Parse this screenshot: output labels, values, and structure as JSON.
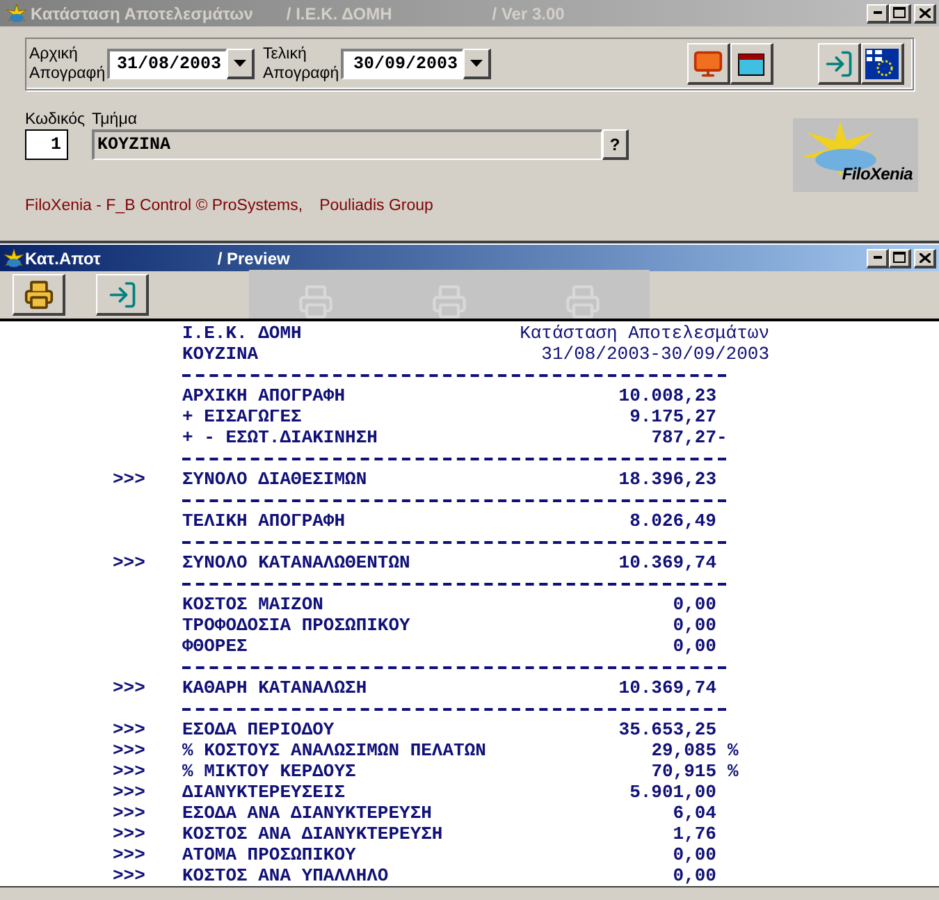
{
  "main_window": {
    "title": "Κατάσταση Αποτελεσμάτων",
    "title_org": "/ Ι.Ε.Κ. ΔΟΜΗ",
    "title_version": "/ Ver 3.00",
    "active": false
  },
  "period": {
    "start_label": "Αρχική Απογραφή",
    "start_value": "31/08/2003",
    "end_label": "Τελική Απογραφή",
    "end_value": "30/09/2003"
  },
  "department": {
    "code_label": "Κωδικός",
    "code_value": "1",
    "name_label": "Τμήμα",
    "name_value": "ΚΟΥΖΙΝΑ",
    "lookup": "?"
  },
  "logo": {
    "text": "FiloXenia"
  },
  "footer": {
    "credits": "FiloXenia - F_B Control © ProSystems,",
    "group": "Pouliadis Group"
  },
  "preview_window": {
    "title": "Κατ.Αποτ",
    "subtitle": "/ Preview",
    "active": true
  },
  "report": {
    "header": [
      {
        "left": "Ι.Ε.Κ. ΔΟΜΗ",
        "right": "Κατάσταση Αποτελεσμάτων"
      },
      {
        "left": "ΚΟΥΖΙΝΑ",
        "right": "31/08/2003-30/09/2003"
      }
    ],
    "lines": [
      {
        "kind": "rule"
      },
      {
        "kind": "item",
        "label": "ΑΡΧΙΚΗ ΑΠΟΓΡΑΦΗ",
        "value": "10.008,23"
      },
      {
        "kind": "item",
        "label": "+ ΕΙΣΑΓΩΓΕΣ",
        "value": "9.175,27"
      },
      {
        "kind": "item",
        "label": "+ - ΕΣΩΤ.ΔΙΑΚΙΝΗΣΗ",
        "value": "787,27",
        "sign": "-"
      },
      {
        "kind": "rule"
      },
      {
        "kind": "item",
        "marker": ">>>",
        "label": "ΣΥΝΟΛΟ ΔΙΑΘΕΣΙΜΩΝ",
        "value": "18.396,23"
      },
      {
        "kind": "rule"
      },
      {
        "kind": "item",
        "label": "ΤΕΛΙΚΗ ΑΠΟΓΡΑΦΗ",
        "value": "8.026,49"
      },
      {
        "kind": "rule"
      },
      {
        "kind": "item",
        "marker": ">>>",
        "label": "ΣΥΝΟΛΟ ΚΑΤΑΝΑΛΩΘΕΝΤΩΝ",
        "value": "10.369,74"
      },
      {
        "kind": "rule"
      },
      {
        "kind": "item",
        "label": "ΚΟΣΤΟΣ ΜΑΙΖΟΝ",
        "value": "0,00"
      },
      {
        "kind": "item",
        "label": "ΤΡΟΦΟΔΟΣΙΑ ΠΡΟΣΩΠΙΚΟΥ",
        "value": "0,00"
      },
      {
        "kind": "item",
        "label": "ΦΘΟΡΕΣ",
        "value": "0,00"
      },
      {
        "kind": "rule"
      },
      {
        "kind": "item",
        "marker": ">>>",
        "label": "ΚΑΘΑΡΗ ΚΑΤΑΝΑΛΩΣΗ",
        "value": "10.369,74"
      },
      {
        "kind": "rule"
      },
      {
        "kind": "item",
        "marker": ">>>",
        "label": "ΕΣΟΔΑ ΠΕΡΙΟΔΟΥ",
        "value": "35.653,25"
      },
      {
        "kind": "item",
        "marker": ">>>",
        "label": "% ΚΟΣΤΟΥΣ ΑΝΑΛΩΣΙΜΩΝ ΠΕΛΑΤΩΝ",
        "value": "29,085",
        "unit": "%"
      },
      {
        "kind": "item",
        "marker": ">>>",
        "label": "% ΜΙΚΤΟΥ ΚΕΡΔΟΥΣ",
        "value": "70,915",
        "unit": "%"
      },
      {
        "kind": "item",
        "marker": ">>>",
        "label": "ΔΙΑΝΥΚΤΕΡΕΥΣΕΙΣ",
        "value": "5.901,00"
      },
      {
        "kind": "item",
        "marker": ">>>",
        "label": "ΕΣΟΔΑ ΑΝΑ ΔΙΑΝΥΚΤΕΡΕΥΣΗ",
        "value": "6,04"
      },
      {
        "kind": "item",
        "marker": ">>>",
        "label": "ΚΟΣΤΟΣ ΑΝΑ ΔΙΑΝΥΚΤΕΡΕΥΣΗ",
        "value": "1,76"
      },
      {
        "kind": "item",
        "marker": ">>>",
        "label": "ΑΤΟΜΑ ΠΡΟΣΩΠΙΚΟΥ",
        "value": "0,00"
      },
      {
        "kind": "item",
        "marker": ">>>",
        "label": "ΚΟΣΤΟΣ ΑΝΑ ΥΠΑΛΛΗΛΟ",
        "value": "0,00"
      }
    ]
  }
}
